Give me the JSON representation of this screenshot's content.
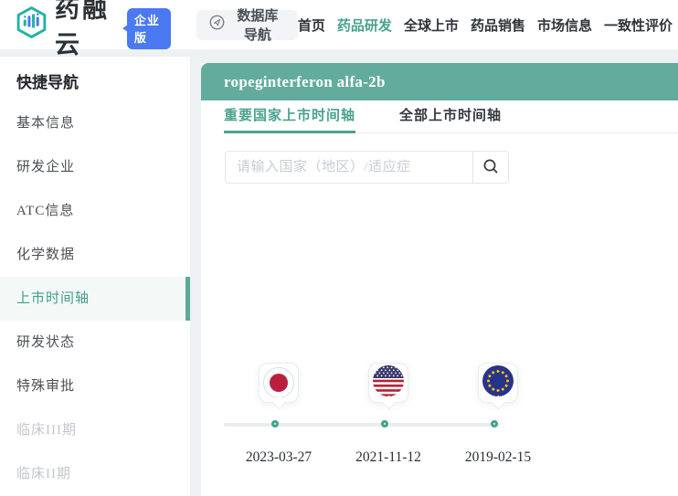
{
  "header": {
    "logo_text": "药融云",
    "edition_badge": "企业版",
    "db_nav_label": "数据库导航",
    "nav": [
      {
        "label": "首页",
        "active": false
      },
      {
        "label": "药品研发",
        "active": true
      },
      {
        "label": "全球上市",
        "active": false
      },
      {
        "label": "药品销售",
        "active": false
      },
      {
        "label": "市场信息",
        "active": false
      },
      {
        "label": "一致性评价",
        "active": false
      }
    ]
  },
  "sidebar": {
    "title": "快捷导航",
    "items": [
      {
        "label": "基本信息",
        "state": "normal"
      },
      {
        "label": "研发企业",
        "state": "normal"
      },
      {
        "label": "ATC信息",
        "state": "normal"
      },
      {
        "label": "化学数据",
        "state": "normal"
      },
      {
        "label": "上市时间轴",
        "state": "selected"
      },
      {
        "label": "研发状态",
        "state": "normal"
      },
      {
        "label": "特殊审批",
        "state": "normal"
      },
      {
        "label": "临床III期",
        "state": "muted"
      },
      {
        "label": "临床II期",
        "state": "muted"
      }
    ]
  },
  "main": {
    "drug_title": "ropeginterferon alfa-2b",
    "tabs": [
      {
        "label": "重要国家上市时间轴",
        "active": true
      },
      {
        "label": "全部上市时间轴",
        "active": false
      }
    ],
    "search_placeholder": "请输入国家（地区）/适应症",
    "timeline": [
      {
        "country": "japan",
        "date": "2023-03-27"
      },
      {
        "country": "usa",
        "date": "2021-11-12"
      },
      {
        "country": "eu",
        "date": "2019-02-15"
      }
    ]
  },
  "colors": {
    "header_teal": "#63ac9d",
    "active_teal": "#49a38d",
    "badge_blue": "#4a79f2",
    "japan_red": "#bc1f3e",
    "us_navy": "#3c3b6e",
    "us_red": "#b22234",
    "eu_blue": "#27348b",
    "eu_star": "#f7c600"
  }
}
